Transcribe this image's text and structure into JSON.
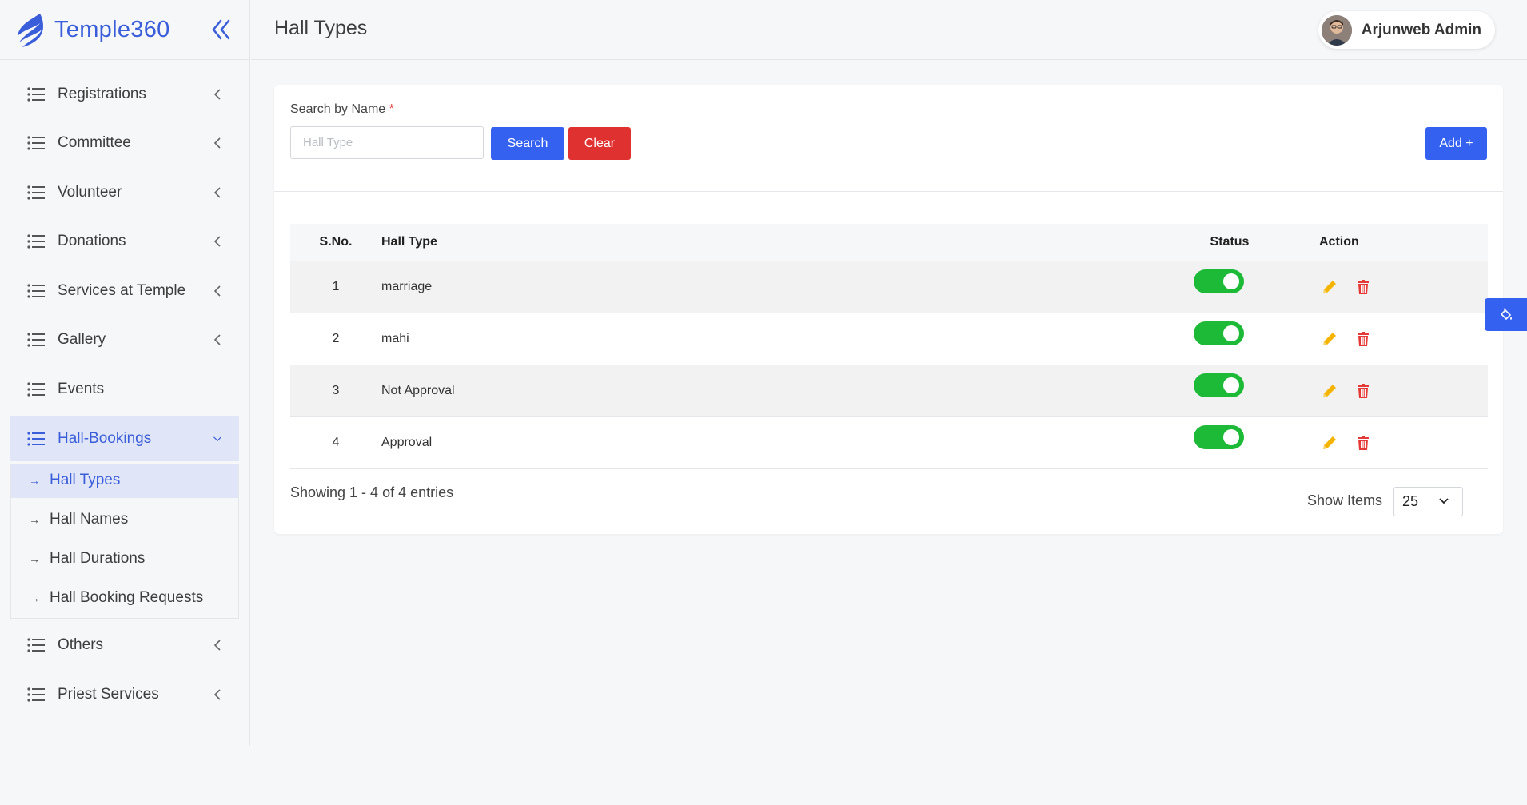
{
  "brand": {
    "name": "Temple360"
  },
  "header": {
    "title": "Hall Types"
  },
  "user": {
    "name": "Arjunweb Admin"
  },
  "sidebar": {
    "items": [
      {
        "label": "Registrations",
        "has_chevron": true
      },
      {
        "label": "Committee",
        "has_chevron": true
      },
      {
        "label": "Volunteer",
        "has_chevron": true
      },
      {
        "label": "Donations",
        "has_chevron": true
      },
      {
        "label": "Services at Temple",
        "has_chevron": true
      },
      {
        "label": "Gallery",
        "has_chevron": true
      },
      {
        "label": "Events",
        "has_chevron": false
      },
      {
        "label": "Hall-Bookings",
        "has_chevron": true,
        "expanded": true
      }
    ],
    "submenu": [
      {
        "label": "Hall Types",
        "active": true
      },
      {
        "label": "Hall Names"
      },
      {
        "label": "Hall Durations"
      },
      {
        "label": "Hall Booking Requests"
      }
    ],
    "after_items": [
      {
        "label": "Others",
        "has_chevron": true
      },
      {
        "label": "Priest Services",
        "has_chevron": true
      }
    ]
  },
  "search": {
    "label": "Search by Name",
    "required_mark": "*",
    "placeholder": "Hall Type",
    "value": "",
    "search_label": "Search",
    "clear_label": "Clear",
    "add_label": "Add +"
  },
  "table": {
    "columns": [
      "S.No.",
      "Hall Type",
      "Status",
      "Action"
    ],
    "rows": [
      {
        "sno": "1",
        "hall_type": "marriage",
        "status": true
      },
      {
        "sno": "2",
        "hall_type": "mahi",
        "status": true
      },
      {
        "sno": "3",
        "hall_type": "Not Approval",
        "status": true
      },
      {
        "sno": "4",
        "hall_type": "Approval",
        "status": true
      }
    ]
  },
  "footer": {
    "showing": "Showing 1 - 4 of 4 entries",
    "show_items_label": "Show Items",
    "page_size": "25"
  },
  "colors": {
    "accent": "#3461f0",
    "danger": "#e03131",
    "toggle_on": "#1cba36",
    "edit": "#f5b400",
    "delete": "#e53935"
  }
}
